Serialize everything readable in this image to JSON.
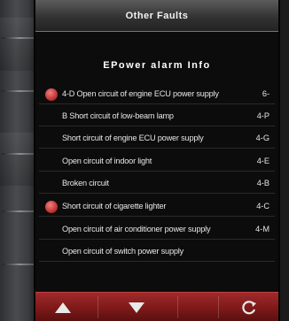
{
  "window": {
    "title": "Other Faults"
  },
  "panel": {
    "subtitle": "EPower alarm Info"
  },
  "faults": [
    {
      "text": "4-D Open circuit of engine ECU power supply",
      "code": "6-",
      "alarm": true
    },
    {
      "text": "B Short circuit of low-beam lamp",
      "code": "4-P",
      "alarm": false
    },
    {
      "text": "Short circuit of engine ECU power supply",
      "code": "4-G",
      "alarm": false
    },
    {
      "text": "Open circuit of indoor light",
      "code": "4-E",
      "alarm": false
    },
    {
      "text": "Broken circuit",
      "code": "4-B",
      "alarm": false
    },
    {
      "text": "Short circuit of cigarette lighter",
      "code": "4-C",
      "alarm": true
    },
    {
      "text": "Open circuit of air conditioner power supply",
      "code": "4-M",
      "alarm": false
    },
    {
      "text": "Open circuit of switch power supply",
      "code": "",
      "alarm": false
    }
  ],
  "colors": {
    "accent": "#8b1e1e",
    "alarm_dot": "#c83a3a",
    "text": "#e6e6e6"
  },
  "controls": {
    "up_icon": "triangle-up-icon",
    "down_icon": "triangle-down-icon",
    "refresh_icon": "refresh-icon"
  }
}
